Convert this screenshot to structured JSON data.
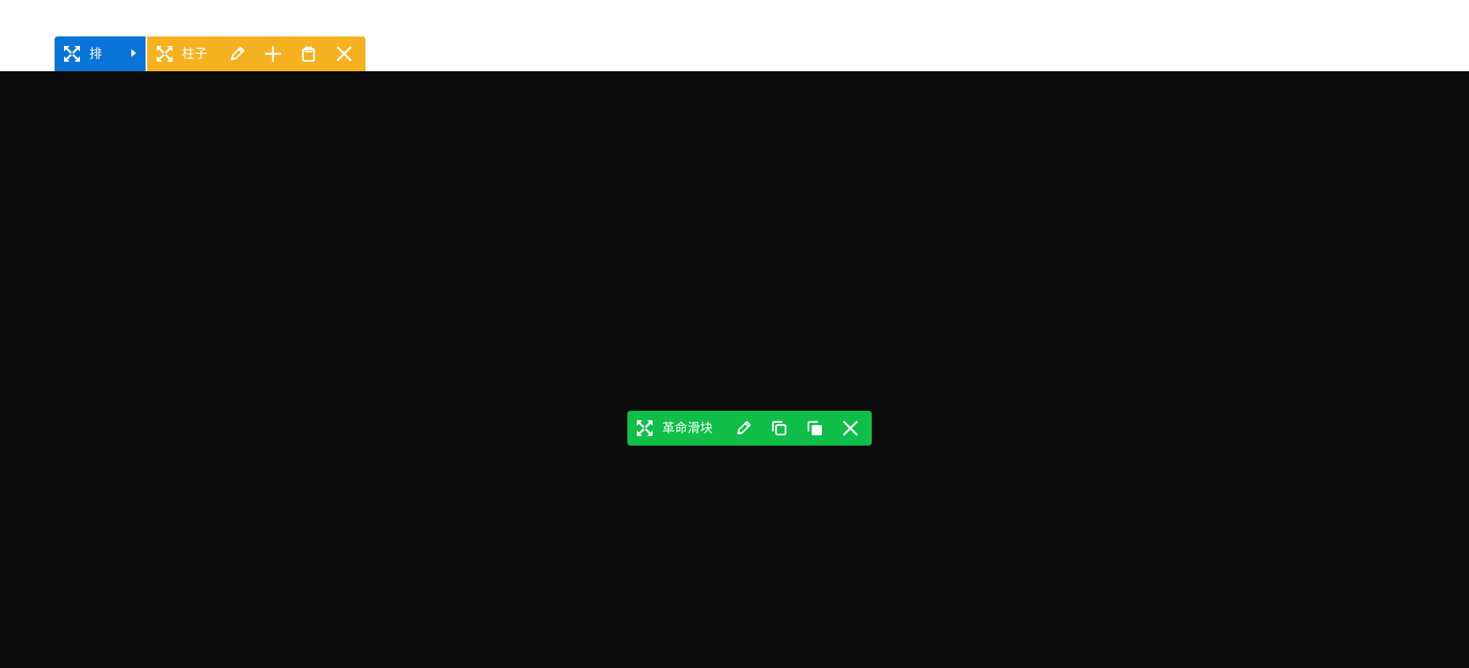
{
  "colors": {
    "row_bar": "#0b74d8",
    "column_bar": "#f6b120",
    "module_bar": "#0fbf48",
    "stage_background": "#0b0b0b",
    "page_background": "#ffffff",
    "icon": "#ffffff"
  },
  "row_toolbar": {
    "label": "排",
    "icons": [
      "move-icon",
      "caret-right-icon"
    ]
  },
  "column_toolbar": {
    "label": "柱子",
    "icons": [
      "move-icon",
      "pencil-icon",
      "plus-icon",
      "clipboard-icon",
      "close-icon"
    ]
  },
  "module_toolbar": {
    "label": "革命滑块",
    "icons": [
      "move-icon",
      "pencil-icon",
      "duplicate-icon",
      "copy-icon",
      "close-icon"
    ]
  }
}
